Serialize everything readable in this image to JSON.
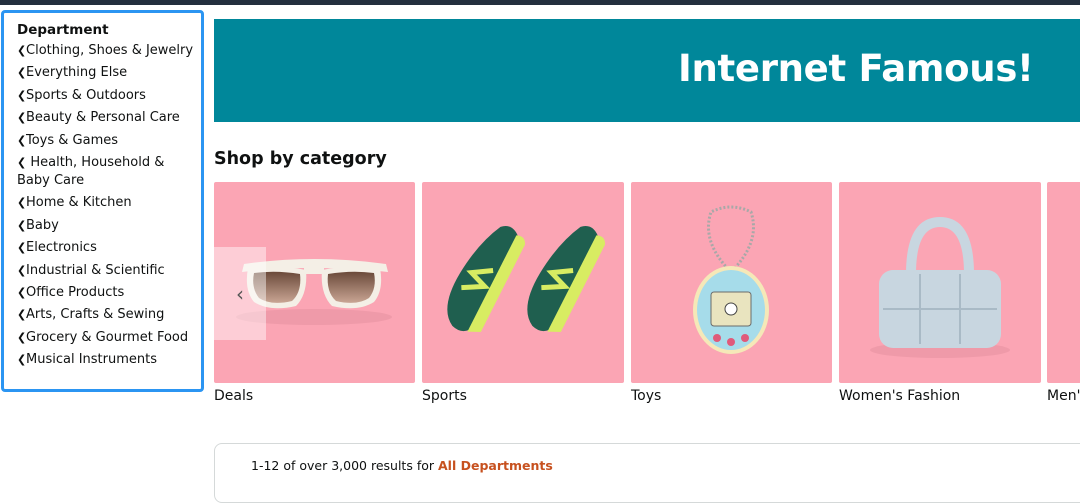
{
  "sidebar": {
    "title": "Department",
    "items": [
      {
        "label": "Clothing, Shoes & Jewelry"
      },
      {
        "label": "Everything Else"
      },
      {
        "label": "Sports & Outdoors"
      },
      {
        "label": "Beauty & Personal Care"
      },
      {
        "label": "Toys & Games"
      },
      {
        "label": "Health, Household & Baby Care"
      },
      {
        "label": "Home & Kitchen"
      },
      {
        "label": "Baby"
      },
      {
        "label": "Electronics"
      },
      {
        "label": "Industrial & Scientific"
      },
      {
        "label": "Office Products"
      },
      {
        "label": "Arts, Crafts & Sewing"
      },
      {
        "label": "Grocery & Gourmet Food"
      },
      {
        "label": "Musical Instruments"
      }
    ]
  },
  "banner": {
    "title": "Internet Famous!",
    "bg_color": "#00879a"
  },
  "shop": {
    "title": "Shop by category",
    "cards": [
      {
        "label": "Deals",
        "icon": "sunglasses-icon"
      },
      {
        "label": "Sports",
        "icon": "sneakers-icon"
      },
      {
        "label": "Toys",
        "icon": "tamagotchi-icon"
      },
      {
        "label": "Women's Fashion",
        "icon": "puffer-bag-icon"
      },
      {
        "label": "Men's"
      }
    ],
    "card_color": "#fba5b4"
  },
  "results": {
    "prefix": "1-12 of over 3,000 results for",
    "link": "All Departments"
  },
  "accent_color": "#2b95f2"
}
